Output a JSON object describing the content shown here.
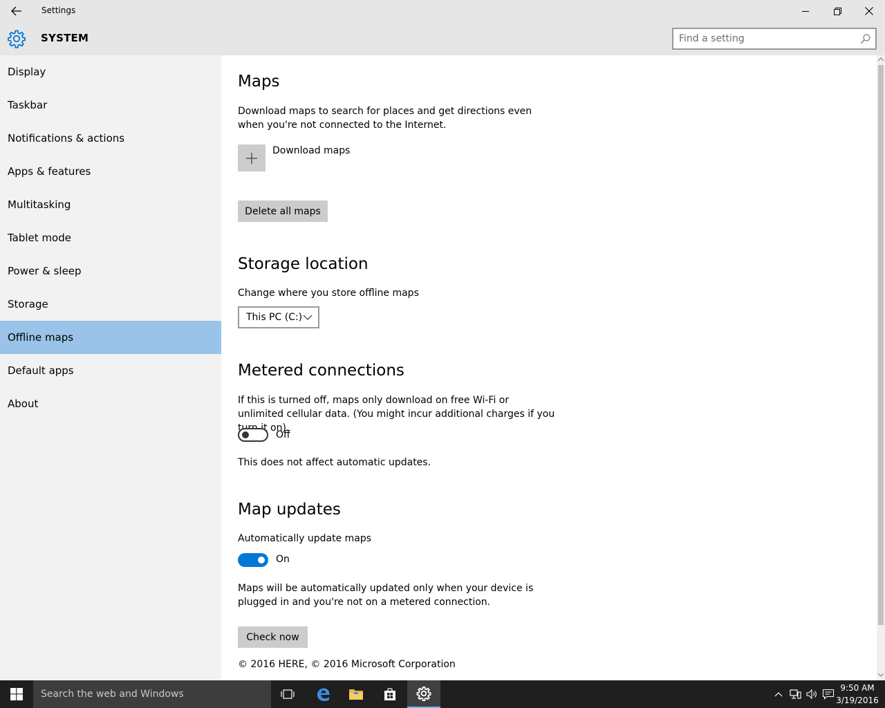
{
  "window": {
    "title": "Settings"
  },
  "header": {
    "section": "SYSTEM",
    "search_placeholder": "Find a setting"
  },
  "sidebar": {
    "items": [
      {
        "label": "Display"
      },
      {
        "label": "Taskbar"
      },
      {
        "label": "Notifications & actions"
      },
      {
        "label": "Apps & features"
      },
      {
        "label": "Multitasking"
      },
      {
        "label": "Tablet mode"
      },
      {
        "label": "Power & sleep"
      },
      {
        "label": "Storage"
      },
      {
        "label": "Offline maps",
        "selected": true
      },
      {
        "label": "Default apps"
      },
      {
        "label": "About"
      }
    ]
  },
  "main": {
    "maps": {
      "heading": "Maps",
      "description": "Download maps to search for places and get directions even when you're not connected to the Internet.",
      "download_label": "Download maps",
      "delete_label": "Delete all maps"
    },
    "storage": {
      "heading": "Storage location",
      "label": "Change where you store offline maps",
      "selected": "This PC (C:)"
    },
    "metered": {
      "heading": "Metered connections",
      "description": "If this is turned off, maps only download on free Wi-Fi or unlimited cellular data. (You might incur additional charges if you turn it on).",
      "toggle_state": "Off",
      "note": "This does not affect automatic updates."
    },
    "updates": {
      "heading": "Map updates",
      "label": "Automatically update maps",
      "toggle_state": "On",
      "description": "Maps will be automatically updated only when your device is plugged in and you're not on a metered connection.",
      "check_label": "Check now"
    },
    "copyright": "© 2016 HERE, © 2016 Microsoft Corporation"
  },
  "taskbar": {
    "search_placeholder": "Search the web and Windows",
    "time": "9:50 AM",
    "date": "3/19/2016"
  },
  "colors": {
    "accent": "#0078d7",
    "selected_nav": "#99c3e8",
    "chrome": "#e6e6e6",
    "sidebar": "#f2f2f2",
    "taskbar": "#1f1f1f"
  }
}
